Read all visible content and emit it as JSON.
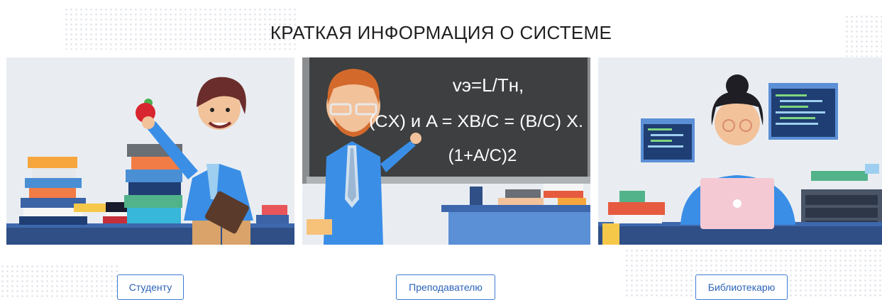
{
  "section": {
    "title": "КРАТКАЯ ИНФОРМАЦИЯ О СИСТЕМЕ"
  },
  "cards": [
    {
      "button_label": "Студенту",
      "illustration": "student-illustration"
    },
    {
      "button_label": "Преподавателю",
      "illustration": "teacher-illustration",
      "board_lines": [
        "vэ=L/Tн,",
        "(CX) и A = XB/C = (B/C) X.",
        "(1+A/C)2"
      ]
    },
    {
      "button_label": "Библиотекарю",
      "illustration": "librarian-illustration"
    }
  ],
  "colors": {
    "accent": "#3a7bd5",
    "button_text": "#2b63b8",
    "panel_bg": "#e8ecf2",
    "chalkboard": "#3d3f40"
  }
}
